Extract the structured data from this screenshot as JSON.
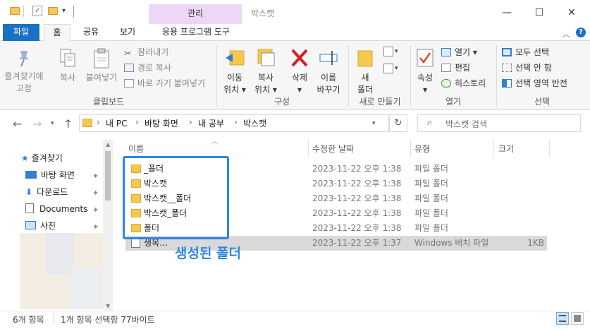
{
  "window": {
    "title": "박스캣",
    "context_tab": "관리",
    "buttons": {
      "minimize": "—",
      "maximize": "☐",
      "close": "✕"
    }
  },
  "ribbon_tabs": [
    "파일",
    "홈",
    "공유",
    "보기",
    "응용 프로그램 도구"
  ],
  "ribbon": {
    "clipboard": {
      "label": "클립보드",
      "pin": "즐겨찾기에\n고정",
      "copy": "복사",
      "paste": "붙여넣기",
      "cut": "잘라내기",
      "copy_path": "경로 복사",
      "paste_shortcut": "바로 가기 붙여넣기"
    },
    "organize": {
      "label": "구성",
      "move_to": "이동\n위치 ▾",
      "copy_to": "복사\n위치 ▾",
      "delete": "삭제\n▾",
      "rename": "이름\n바꾸기"
    },
    "new": {
      "label": "새로 만들기",
      "new_folder": "새\n폴더"
    },
    "open": {
      "label": "열기",
      "properties": "속성\n▾",
      "open": "열기 ▾",
      "edit": "편집",
      "history": "히스토리"
    },
    "select": {
      "label": "선택",
      "select_all": "모두 선택",
      "select_none": "선택 안 함",
      "invert": "선택 영역 반전"
    }
  },
  "address": {
    "crumbs": [
      "내 PC",
      "바탕 화면",
      "내 공부",
      "박스캣"
    ],
    "search_placeholder": "박스캣 검색"
  },
  "sidebar": {
    "items": [
      {
        "label": "즐겨찾기"
      },
      {
        "label": "바탕 화면"
      },
      {
        "label": "다운로드"
      },
      {
        "label": "Documents"
      },
      {
        "label": "사진"
      }
    ]
  },
  "columns": {
    "name": "이름",
    "date": "수정한 날짜",
    "type": "유형",
    "size": "크기"
  },
  "files": [
    {
      "name": "_폴더",
      "date": "2023-11-22 오후 1:38",
      "type": "파일 폴더",
      "size": ""
    },
    {
      "name": "박스캣",
      "date": "2023-11-22 오후 1:38",
      "type": "파일 폴더",
      "size": ""
    },
    {
      "name": "박스캣__폴더",
      "date": "2023-11-22 오후 1:38",
      "type": "파일 폴더",
      "size": ""
    },
    {
      "name": "박스캣_폴더",
      "date": "2023-11-22 오후 1:38",
      "type": "파일 폴더",
      "size": ""
    },
    {
      "name": "폴더",
      "date": "2023-11-22 오후 1:38",
      "type": "파일 폴더",
      "size": ""
    },
    {
      "name": "생목…",
      "date": "2023-11-22 오후 1:37",
      "type": "Windows 배치 파일",
      "size": "1KB"
    }
  ],
  "annotation": "생성된 폴더",
  "status": {
    "count": "6개 항목",
    "selection": "1개 항목 선택함 77바이트"
  },
  "colors": {
    "file_tab": "#1a70c5",
    "highlight": "#2f86e0",
    "context_tab": "#ecd8f5"
  }
}
